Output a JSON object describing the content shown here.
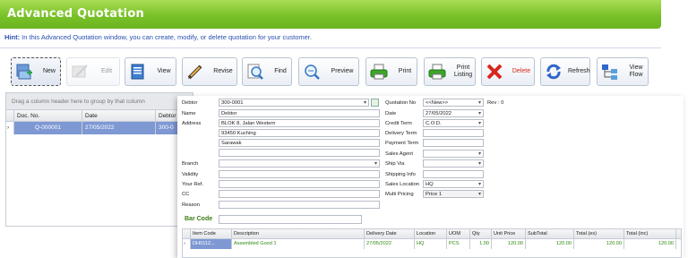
{
  "window": {
    "title": "Advanced Quotation"
  },
  "hint": {
    "prefix": "Hint:",
    "text": "In this Advanced Quotation window, you can create, modify, or delete quotation for your customer."
  },
  "toolbar": {
    "new": "New",
    "edit": "Edit",
    "view": "View",
    "revise": "Revise",
    "find": "Find",
    "preview": "Preview",
    "print": "Print",
    "print_listing_1": "Print",
    "print_listing_2": "Listing",
    "delete": "Delete",
    "refresh": "Refresh",
    "view_flow_1": "View",
    "view_flow_2": "Flow",
    "colors": {
      "green": "#3da52b",
      "red": "#d7261e",
      "blue": "#2f66c9"
    }
  },
  "list": {
    "group_hint": "Drag a column header here to group by that column",
    "columns": [
      "Doc. No.",
      "Date",
      "Debtor"
    ],
    "rows": [
      {
        "doc_no": "Q-000001",
        "date": "27/05/2022",
        "debtor": "300-0"
      }
    ]
  },
  "form": {
    "labels": {
      "debtor": "Debtor",
      "name": "Name",
      "address": "Address",
      "branch": "Branch",
      "validity": "Validity",
      "your_ref": "Your Ref.",
      "cc": "CC",
      "reason": "Reason",
      "quotation_no": "Quotation No",
      "date": "Date",
      "credit_term": "Credit Term",
      "delivery_term": "Delivery Term",
      "payment_term": "Payment Term",
      "sales_agent": "Sales Agent",
      "ship_via": "Ship Via",
      "shipping_info": "Shipping Info",
      "sales_location": "Sales Location",
      "multi_pricing": "Multi Pricing"
    },
    "values": {
      "debtor": "300-0001",
      "name": "Debtor",
      "address1": "BLOK 8, Jalan Western",
      "address2": "93450 Kuching",
      "address3": "Sarawak",
      "quotation_no": "<<New>>",
      "rev": "Rev : 0",
      "date": "27/05/2022",
      "credit_term": "C.O.D.",
      "sales_location": "HQ",
      "multi_pricing": "Price 1"
    },
    "barcode_label": "Bar Code"
  },
  "detail": {
    "columns": [
      "Item Code",
      "Description",
      "Delivery Date",
      "Location",
      "UOM",
      "Qty",
      "Unit Price",
      "SubTotal",
      "Total (ex)",
      "Total (inc)"
    ],
    "row": {
      "item_code": "DH0112...",
      "description": "Assembled Good 1",
      "delivery_date": "27/05/2022",
      "location": "HQ",
      "uom": "PCS",
      "qty": "1.00",
      "unit_price": "120.00",
      "subtotal": "120.00",
      "total_ex": "120.00",
      "total_inc": "120.00"
    }
  }
}
